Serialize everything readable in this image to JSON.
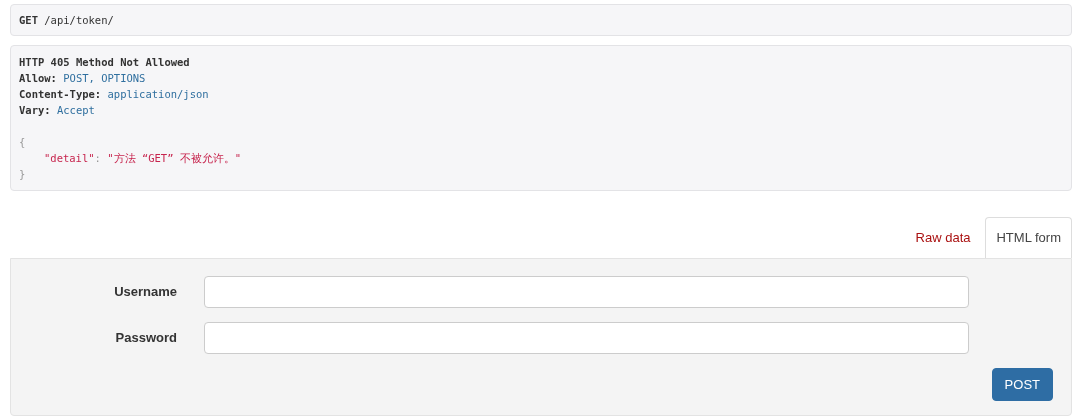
{
  "request": {
    "method": "GET",
    "path": "/api/token/"
  },
  "response": {
    "status": "HTTP 405 Method Not Allowed",
    "headers": [
      {
        "name": "Allow:",
        "value": "POST, OPTIONS"
      },
      {
        "name": "Content-Type:",
        "value": "application/json"
      },
      {
        "name": "Vary:",
        "value": "Accept"
      }
    ],
    "body": {
      "open": "{",
      "key": "\"detail\"",
      "colon": ":",
      "value": "\"方法 “GET” 不被允许。\"",
      "close": "}"
    }
  },
  "tabs": [
    {
      "label": "Raw data",
      "selected": false
    },
    {
      "label": "HTML form",
      "selected": true
    }
  ],
  "form": {
    "fields": [
      {
        "label": "Username"
      },
      {
        "label": "Password"
      }
    ],
    "submit": "POST"
  }
}
